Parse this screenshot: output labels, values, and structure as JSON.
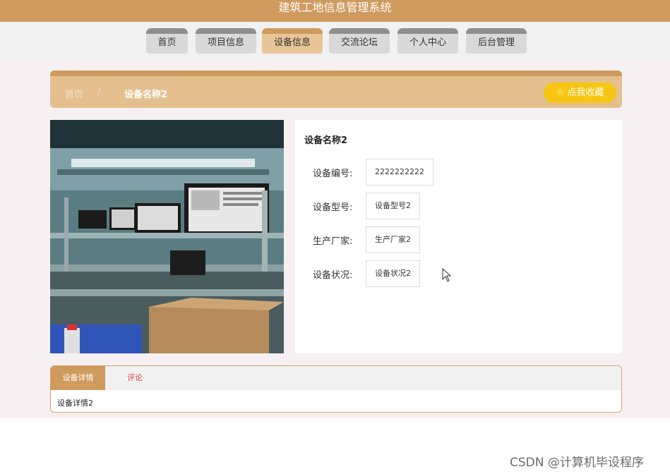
{
  "site": {
    "title": "建筑工地信息管理系统"
  },
  "nav": {
    "tabs": [
      {
        "label": "首页"
      },
      {
        "label": "项目信息"
      },
      {
        "label": "设备信息",
        "active": true
      },
      {
        "label": "交流论坛"
      },
      {
        "label": "个人中心"
      },
      {
        "label": "后台管理"
      }
    ]
  },
  "breadcrumb": {
    "home": "首页",
    "separator": "/",
    "current": "设备名称2"
  },
  "favorite_button": {
    "label": "☆ 点我收藏"
  },
  "equipment": {
    "name": "设备名称2",
    "fields": [
      {
        "label": "设备编号:",
        "value": "2222222222"
      },
      {
        "label": "设备型号:",
        "value": "设备型号2"
      },
      {
        "label": "生产厂家:",
        "value": "生产厂家2"
      },
      {
        "label": "设备状况:",
        "value": "设备状况2"
      }
    ]
  },
  "detail": {
    "tabs": [
      {
        "label": "设备详情"
      },
      {
        "label": "评论"
      }
    ],
    "content": "设备详情2"
  },
  "watermark": "CSDN @计算机毕设程序",
  "colors": {
    "brand": "#cf9a5e",
    "crumb_bg": "#e4c08f",
    "favorite": "#f6c613",
    "comments_tab": "#e64040"
  }
}
